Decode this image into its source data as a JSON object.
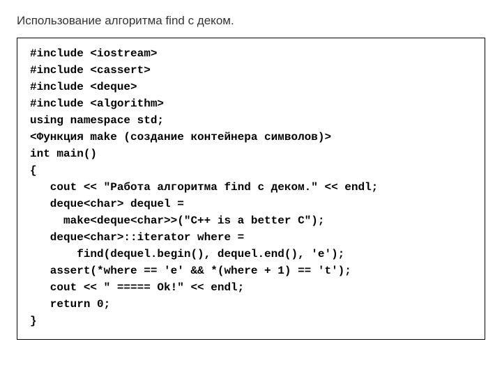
{
  "title": "Использование алгоритма find с деком.",
  "code": {
    "l0": "#include <iostream>",
    "l1": "#include <cassert>",
    "l2": "#include <deque>",
    "l3": "#include <algorithm>",
    "l4": "using namespace std;",
    "l5": "<Функция make (создание контейнера символов)>",
    "l6": "",
    "l7": "int main()",
    "l8": "{",
    "l9": "   cout << \"Работа алгоритма find с деком.\" << endl;",
    "l10": "   deque<char> dequel =",
    "l11": "     make<deque<char>>(\"C++ is a better C\");",
    "l12": "",
    "l13": "   deque<char>::iterator where =",
    "l14": "       find(dequel.begin(), dequel.end(), 'e');",
    "l15": "   assert(*where == 'e' && *(where + 1) == 't');",
    "l16": "   cout << \" ===== Ok!\" << endl;",
    "l17": "   return 0;",
    "l18": "}"
  }
}
